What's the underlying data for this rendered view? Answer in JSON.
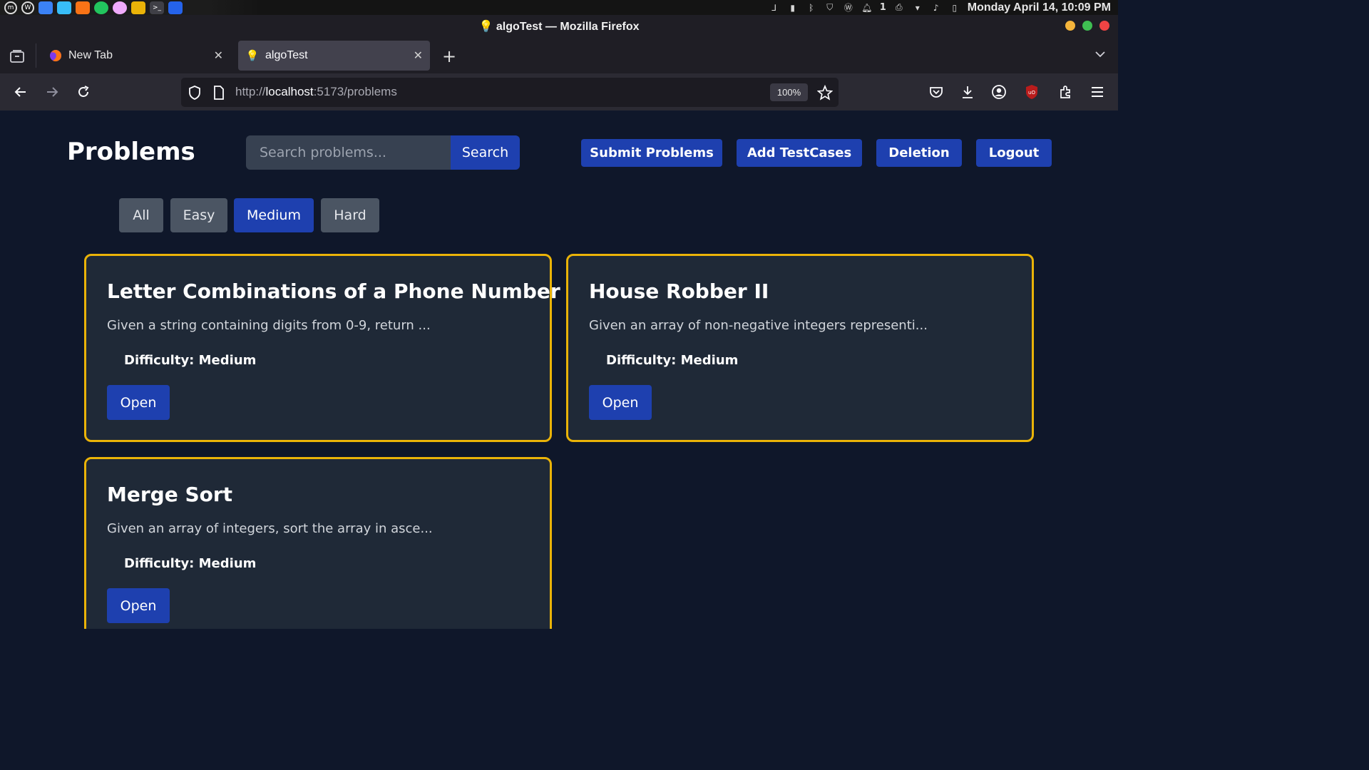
{
  "os_bar": {
    "clock": "Monday April 14, 10:09 PM",
    "notification_count": "1",
    "apps": [
      "mint-menu-icon",
      "wordpress-icon",
      "files-icon",
      "browser-icon",
      "calculator-icon",
      "spotify-icon",
      "app-icon",
      "folder-icon",
      "terminal-icon",
      "vscode-icon"
    ]
  },
  "window": {
    "title": "💡 algoTest — Mozilla Firefox"
  },
  "tabs": [
    {
      "label": "New Tab",
      "close": "✕"
    },
    {
      "label": "algoTest",
      "close": "✕"
    }
  ],
  "nav": {
    "url_prefix": "http://",
    "url_host": "localhost",
    "url_path": ":5173/problems",
    "zoom": "100%"
  },
  "page": {
    "title": "Problems",
    "search_placeholder": "Search problems...",
    "search_button": "Search",
    "header_buttons": [
      "Submit Problems",
      "Add TestCases",
      "Deletion",
      "Logout"
    ],
    "filters": [
      "All",
      "Easy",
      "Medium",
      "Hard"
    ],
    "active_filter": "Medium",
    "accent_color": "#1e40af",
    "card_border_color": "#eab308",
    "problems": [
      {
        "title": "Letter Combinations of a Phone Number",
        "description": "Given a string containing digits from 0-9, return ...",
        "difficulty": "Difficulty: Medium",
        "open_label": "Open"
      },
      {
        "title": "House Robber II",
        "description": "Given an array of non-negative integers representi...",
        "difficulty": "Difficulty: Medium",
        "open_label": "Open"
      },
      {
        "title": "Merge Sort",
        "description": "Given an array of integers, sort the array in asce...",
        "difficulty": "Difficulty: Medium",
        "open_label": "Open"
      }
    ]
  }
}
